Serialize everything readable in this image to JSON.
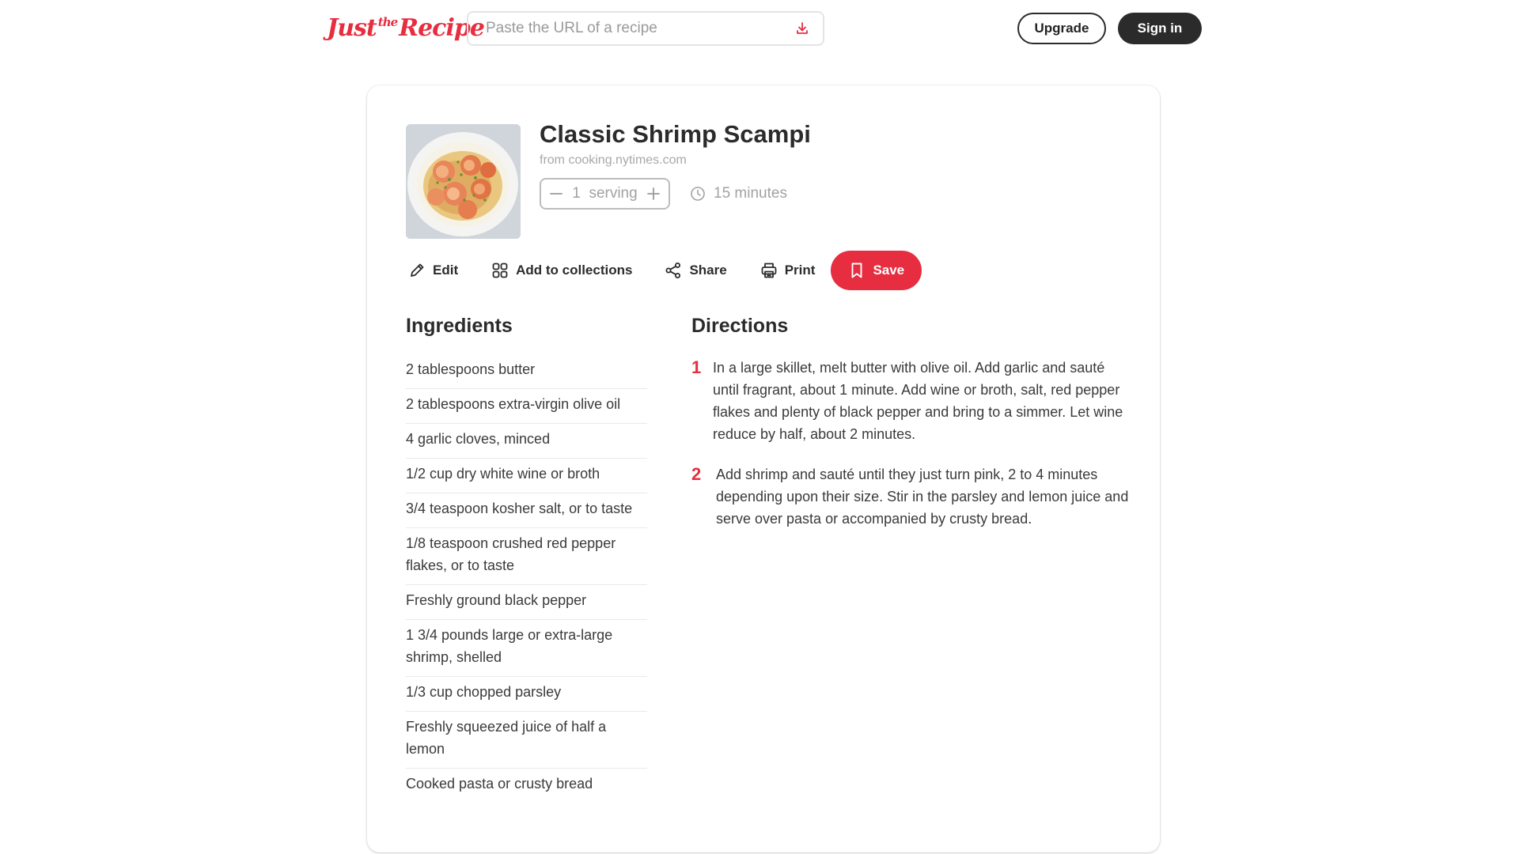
{
  "header": {
    "logo": {
      "part1": "Just",
      "part2": "the",
      "part3": "Recipe"
    },
    "url_placeholder": "Paste the URL of a recipe",
    "upgrade_label": "Upgrade",
    "signin_label": "Sign in"
  },
  "recipe": {
    "title": "Classic Shrimp Scampi",
    "source": "from cooking.nytimes.com",
    "servings": "1",
    "servings_unit": "serving",
    "time": "15 minutes",
    "image": "shrimp scampi photo"
  },
  "actions": {
    "edit": "Edit",
    "add_to_collections": "Add to collections",
    "share": "Share",
    "print": "Print",
    "save": "Save"
  },
  "ingredients": {
    "heading": "Ingredients",
    "items": [
      "2 tablespoons butter",
      "2 tablespoons extra-virgin olive oil",
      "4 garlic cloves, minced",
      "1/2 cup dry white wine or broth",
      "3/4 teaspoon kosher salt, or to taste",
      "1/8 teaspoon crushed red pepper flakes, or to taste",
      "Freshly ground black pepper",
      "1 3/4 pounds large or extra-large shrimp, shelled",
      "1/3 cup chopped parsley",
      "Freshly squeezed juice of half a lemon",
      "Cooked pasta or crusty bread"
    ]
  },
  "directions": {
    "heading": "Directions",
    "steps": [
      {
        "num": "1",
        "text": "In a large skillet, melt butter with olive oil. Add garlic and sauté until fragrant, about 1 minute. Add wine or broth, salt, red pepper flakes and plenty of black pepper and bring to a simmer. Let wine reduce by half, about 2 minutes."
      },
      {
        "num": "2",
        "text": "Add shrimp and sauté until they just turn pink, 2 to 4 minutes depending upon their size. Stir in the parsley and lemon juice and serve over pasta or accompanied by crusty bread."
      }
    ]
  },
  "colors": {
    "brand": "#e62e40",
    "dark": "#2b2b2b",
    "muted": "#a2a2a2"
  }
}
